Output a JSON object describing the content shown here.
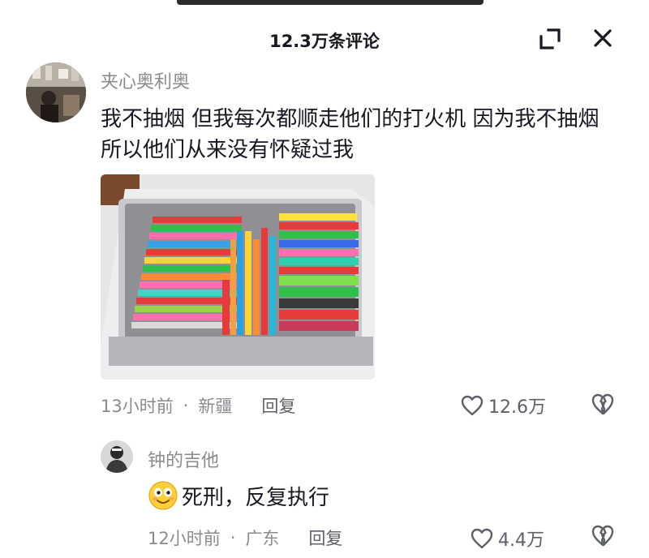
{
  "header": {
    "title": "12.3万条评论"
  },
  "comment": {
    "username": "夹心奥利奥",
    "text": "我不抽烟 但我每次都顺走他们的打火机  因为我不抽烟所以他们从来没有怀疑过我",
    "time": "13小时前",
    "location": "新疆",
    "separator": "·",
    "reply_label": "回复",
    "likes": "12.6万"
  },
  "reply": {
    "username": "钟的吉他",
    "text": "死刑，反复执行",
    "emoji": "smiling-face-emoji",
    "time": "12小时前",
    "location": "广东",
    "separator": "·",
    "reply_label": "回复",
    "likes": "4.4万"
  },
  "icons": {
    "expand": "expand-icon",
    "close": "close-icon",
    "like": "heart-outline-icon",
    "dislike": "broken-heart-icon"
  },
  "colors": {
    "primary_text": "#161823",
    "secondary_text": "#8a8b91",
    "action_text": "#5d5f69",
    "background": "#ffffff"
  }
}
